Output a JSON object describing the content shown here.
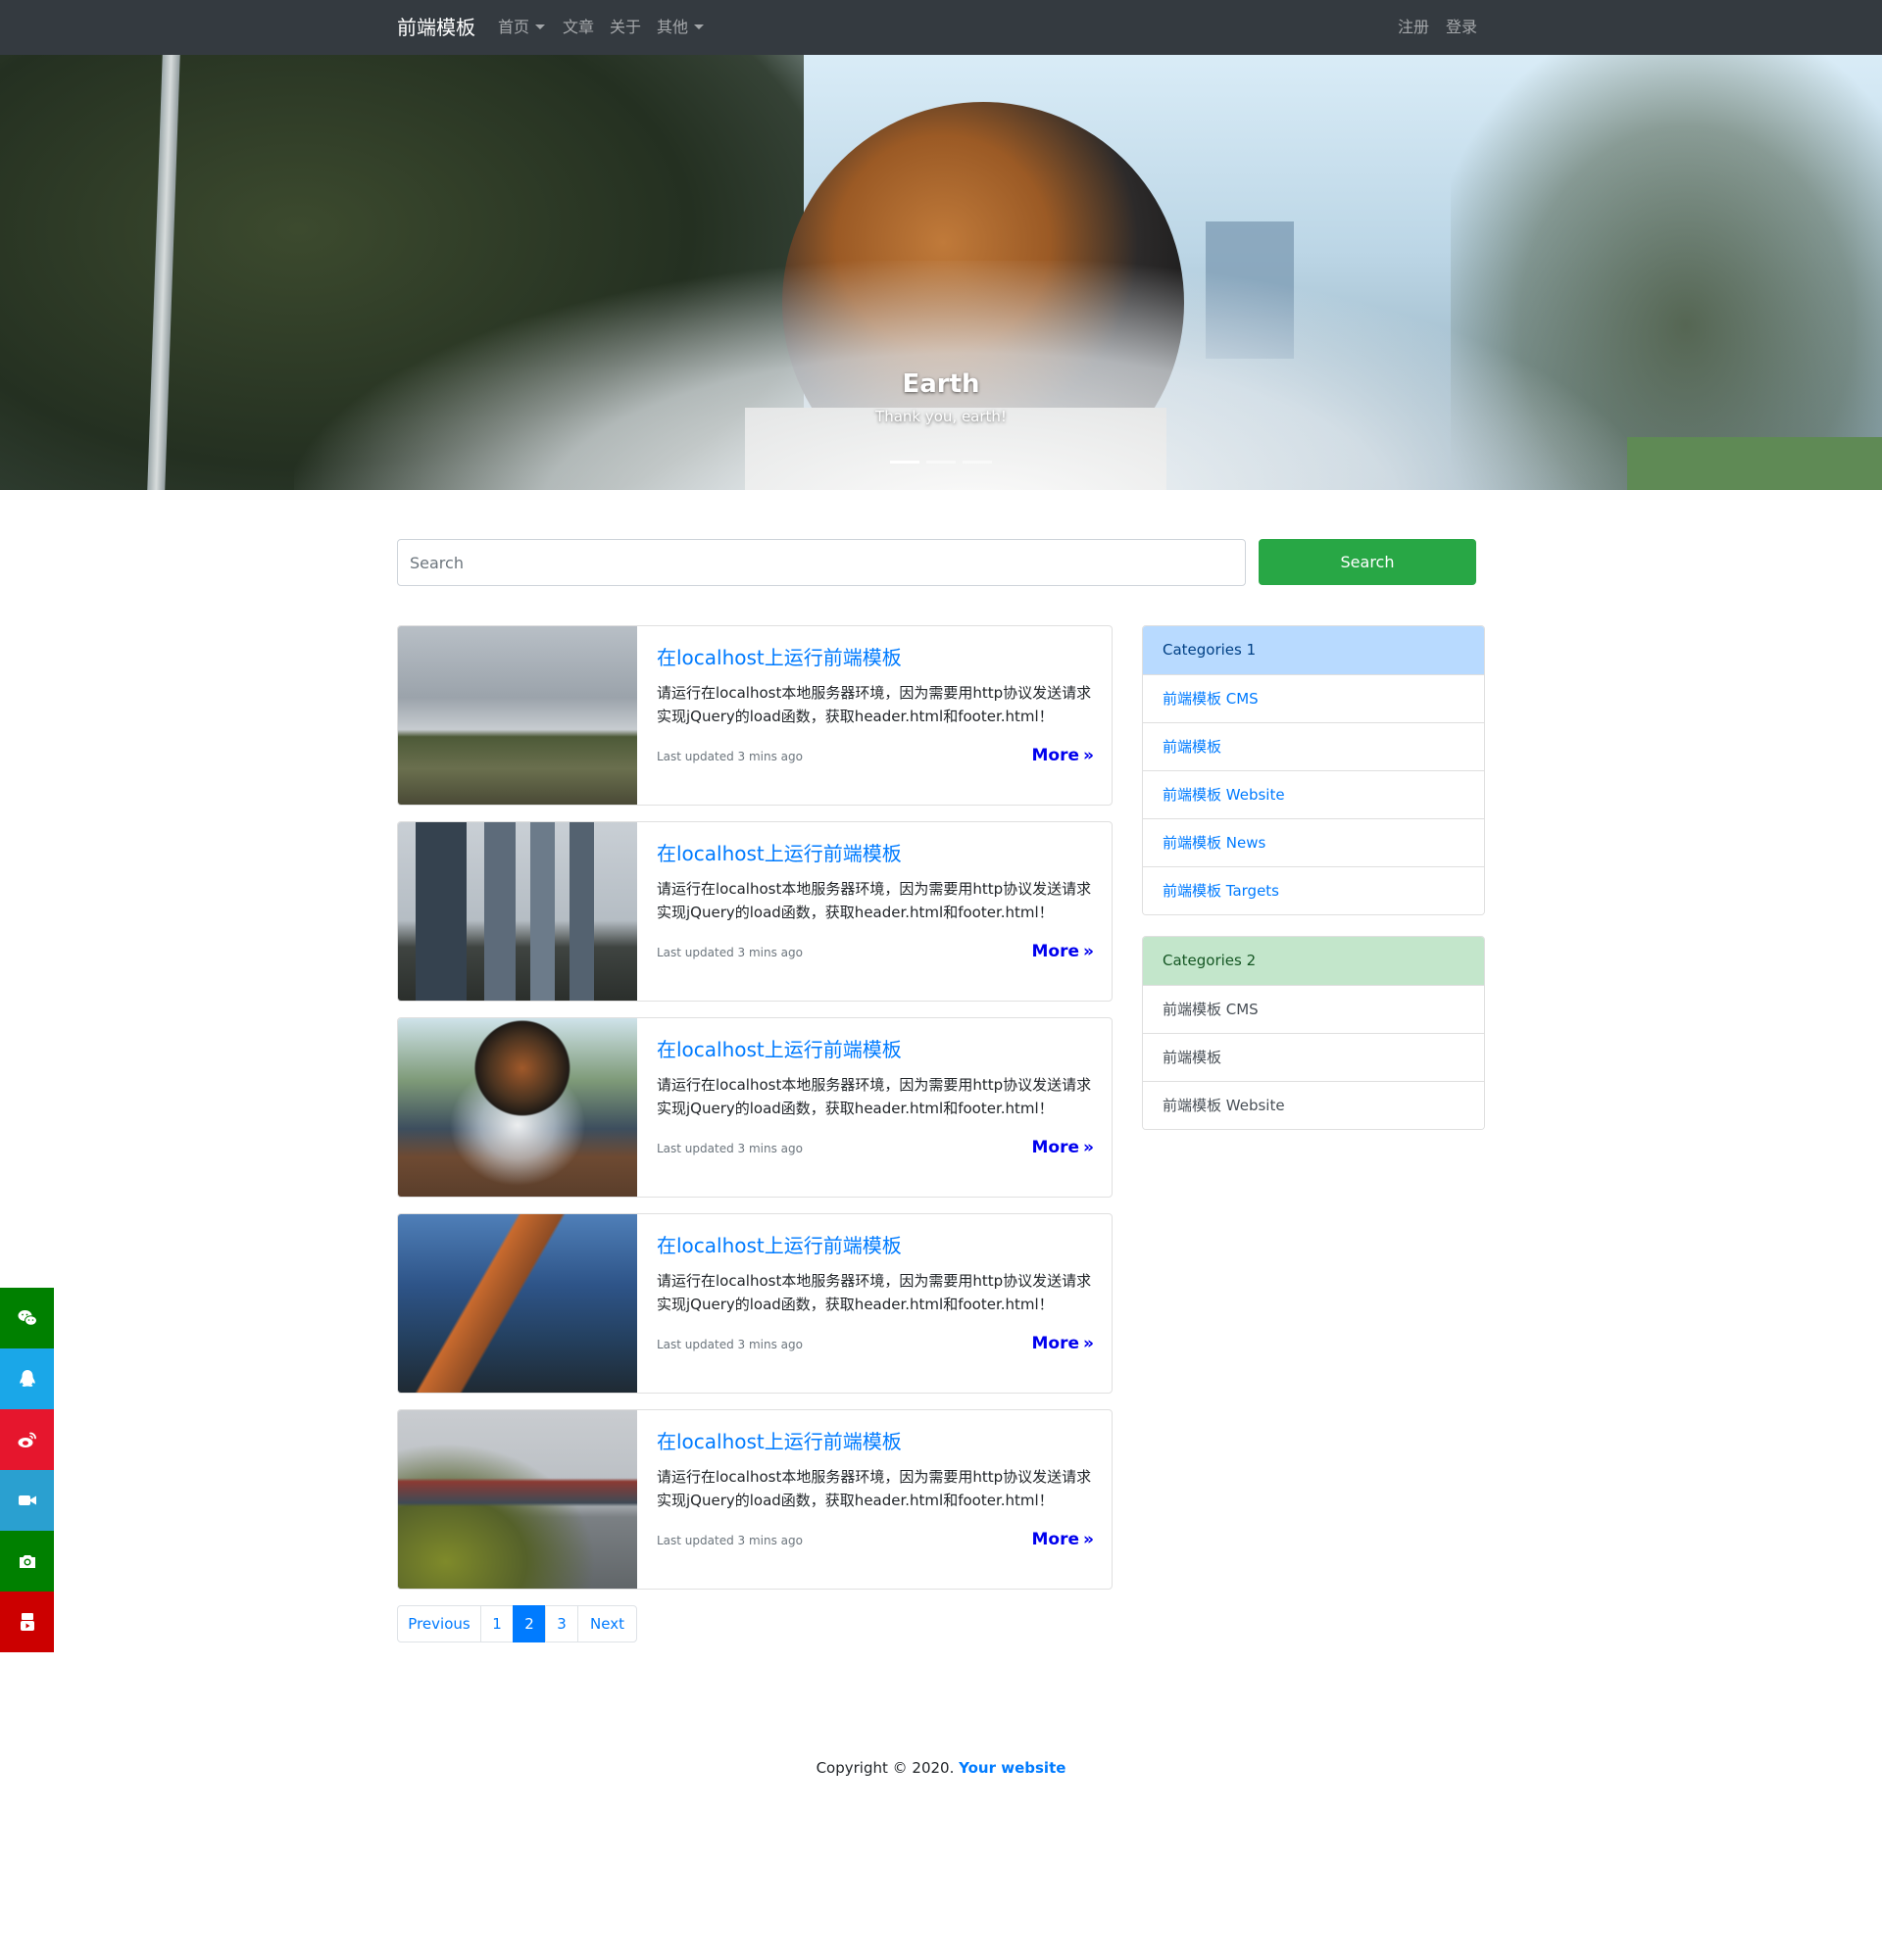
{
  "navbar": {
    "brand": "前端模板",
    "items": [
      {
        "label": "首页",
        "dropdown": true
      },
      {
        "label": "文章",
        "dropdown": false
      },
      {
        "label": "关于",
        "dropdown": false
      },
      {
        "label": "其他",
        "dropdown": true
      }
    ],
    "register": "注册",
    "login": "登录"
  },
  "hero": {
    "title": "Earth",
    "subtitle": "Thank you, earth!",
    "slides_count": 3,
    "active_slide": 1
  },
  "search": {
    "placeholder": "Search",
    "button": "Search"
  },
  "articles": [
    {
      "title": "在localhost上运行前端模板",
      "text": "请运行在localhost本地服务器环境，因为需要用http协议发送请求实现jQuery的load函数，获取header.html和footer.html！",
      "updated": "Last updated 3 mins ago",
      "more": "More",
      "image": "cloudy-field"
    },
    {
      "title": "在localhost上运行前端模板",
      "text": "请运行在localhost本地服务器环境，因为需要用http协议发送请求实现jQuery的load函数，获取header.html和footer.html！",
      "updated": "Last updated 3 mins ago",
      "more": "More",
      "image": "city-street"
    },
    {
      "title": "在localhost上运行前端模板",
      "text": "请运行在localhost本地服务器环境，因为需要用http协议发送请求实现jQuery的load函数，获取header.html和footer.html！",
      "updated": "Last updated 3 mins ago",
      "more": "More",
      "image": "globe-fountain"
    },
    {
      "title": "在localhost上运行前端模板",
      "text": "请运行在localhost本地服务器环境，因为需要用http协议发送请求实现jQuery的load函数，获取header.html和footer.html！",
      "updated": "Last updated 3 mins ago",
      "more": "More",
      "image": "glass-mall"
    },
    {
      "title": "在localhost上运行前端模板",
      "text": "请运行在localhost本地服务器环境，因为需要用http协议发送请求实现jQuery的load函数，获取header.html和footer.html！",
      "updated": "Last updated 3 mins ago",
      "more": "More",
      "image": "harbor-building"
    }
  ],
  "pagination": {
    "previous": "Previous",
    "pages": [
      "1",
      "2",
      "3"
    ],
    "active": "2",
    "next": "Next"
  },
  "sidebar": {
    "categories1": {
      "title": "Categories 1",
      "items": [
        "前端模板 CMS",
        "前端模板",
        "前端模板 Website",
        "前端模板 News",
        "前端模板 Targets"
      ]
    },
    "categories2": {
      "title": "Categories 2",
      "items": [
        "前端模板 CMS",
        "前端模板",
        "前端模板 Website"
      ]
    }
  },
  "social": [
    {
      "icon": "wechat-icon",
      "color": "#008000"
    },
    {
      "icon": "qq-icon",
      "color": "#1aa7e8"
    },
    {
      "icon": "weibo-icon",
      "color": "#e6162d"
    },
    {
      "icon": "video-camera-icon",
      "color": "#2aa0d0"
    },
    {
      "icon": "camera-icon",
      "color": "#008000"
    },
    {
      "icon": "youtube-icon",
      "color": "#cc0000"
    }
  ],
  "footer": {
    "copyright": "Copyright © 2020.",
    "link": "Your website"
  },
  "colors": {
    "navbar": "#343a40",
    "primary": "#007bff",
    "success": "#28a745"
  }
}
